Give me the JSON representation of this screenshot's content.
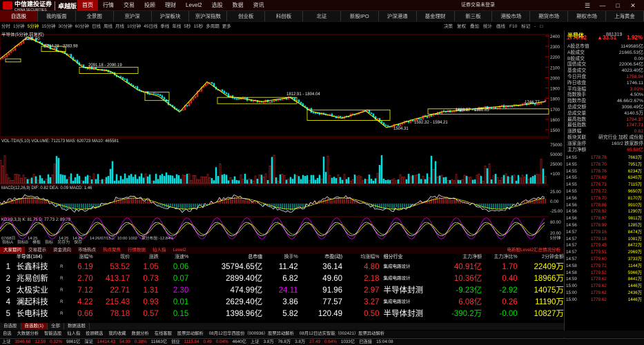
{
  "app": {
    "brand": "中信建投证券",
    "brand_sub": "CHINA SECURITIES",
    "edition": "卓越版",
    "login": "证券交易未登录"
  },
  "menu": [
    "首页",
    "行情",
    "交易",
    "投顾",
    "理财",
    "Level2",
    "选股",
    "数据",
    "资讯"
  ],
  "menu_active": 0,
  "tabs": [
    "自选股",
    "我的版面",
    "全景图",
    "京沪深",
    "沪深板块",
    "京沪深指数",
    "创业板",
    "科创板",
    "北证",
    "新股IPO",
    "沪深港通",
    "基金理财",
    "新三板",
    "港股市场",
    "期货市场",
    "期权市场",
    "上海黄金"
  ],
  "tab_active": 0,
  "periods": [
    "分时",
    "1分钟",
    "5分钟",
    "15分钟",
    "30分钟",
    "60分钟",
    "日线",
    "周线",
    "月线",
    "10分钟",
    "45日线",
    "季线",
    "年线",
    "5秒",
    "15秒",
    "多周期",
    "更多"
  ],
  "period_active": 2,
  "right_tools": [
    "决策",
    "复权",
    "叠加",
    "统计",
    "画线",
    "F10",
    "标记",
    "-",
    "□"
  ],
  "chart": {
    "title": "半导体(5分钟,前复权)",
    "annotations": [
      "2391.60",
      "2244.28 - 2383.98",
      "2091.18 - 2090.19",
      "1812.91 - 1804.04",
      "1686.57 - 1686.65",
      "1746.77",
      "1592.32 - 1594.21",
      "1504.31"
    ],
    "y_labels": [
      "2400",
      "2300",
      "2200",
      "2100",
      "2000",
      "1900",
      "1800",
      "1700",
      "1600",
      "1500"
    ],
    "vol_title": "VOL-TDX(5,10) VOLUME: 712173 MA5: 620723 MA10: 465581",
    "vol_labels": [
      "75000",
      "50000",
      "25000",
      "×100"
    ],
    "macd_title": "MACD(12,26,9) DIF: 0.82 DEA: 0.09 MACD: 1.46",
    "macd_labels": [
      "25.00",
      "0.00",
      "-25.00"
    ],
    "kdj_title": "KDJ(9,3,3) K: 81.75 D: 77.73 J: 89.79",
    "kdj_labels": [
      "80.00",
      "20.00"
    ],
    "dates": [
      "07/08日",
      "14:25",
      "14:25",
      "14:25",
      "14:26/07/15三",
      "10:00 1002",
      "某分布验:-12.84%"
    ],
    "date_right": "5分钟"
  },
  "subbar": [
    "指标A",
    "指标B",
    "模板",
    "指标",
    "另存为",
    "保存"
  ],
  "table_tabs": [
    "大家都问",
    "交易提示",
    "资金流向",
    "市场热点",
    "热点聚焦",
    "行情数据",
    "仙人指",
    "Level2"
  ],
  "table_tab_active": 0,
  "table_tab_right": "电新股Level2汇总情况分析",
  "columns": [
    "",
    "半导体(184)",
    "",
    "涨幅%",
    "现价",
    "涨跌",
    "涨速%",
    "总市值",
    "换手%",
    "市盈(动)",
    "均涨幅%",
    "细分行业",
    "主力净额",
    "主力净比%",
    "2分钟金额",
    "涨停价"
  ],
  "rows": [
    {
      "n": "1",
      "name": "长鑫科技",
      "flag": "R",
      "pct": "6.19",
      "price": "53.52",
      "chg": "1.05",
      "spd": "0.06",
      "mcap": "35794.65亿",
      "turn": "11.42",
      "pe": "36.14",
      "avg": "4.80",
      "ind": "集成电路设计",
      "net": "40.91亿",
      "netpct": "1.70",
      "amt2": "22409万",
      "lim": ""
    },
    {
      "n": "2",
      "name": "兆易创新",
      "flag": "R",
      "pct": "2.70",
      "price": "413.17",
      "chg": "0.73",
      "spd": "0.07",
      "mcap": "2899.40亿",
      "turn": "6.82",
      "pe": "49.60",
      "avg": "2.18",
      "ind": "集成电路设计",
      "net": "10.36亿",
      "netpct": "0.40",
      "amt2": "18966万",
      "lim": ""
    },
    {
      "n": "3",
      "name": "太极实业",
      "flag": "R",
      "pct": "7.12",
      "price": "22.71",
      "chg": "1.31",
      "spd": "2.30",
      "mcap": "474.99亿",
      "turn": "24.11",
      "pe": "91.96",
      "avg": "2.97",
      "ind": "半导体封测",
      "net": "-9.23亿",
      "netpct": "-2.92",
      "amt2": "14075万",
      "lim": ""
    },
    {
      "n": "4",
      "name": "澜起科技",
      "flag": "R",
      "pct": "4.22",
      "price": "215.43",
      "chg": "0.93",
      "spd": "0.01",
      "mcap": "2629.40亿",
      "turn": "3.86",
      "pe": "77.57",
      "avg": "3.27",
      "ind": "集成电路设计",
      "net": "6.08亿",
      "netpct": "0.26",
      "amt2": "11190万",
      "lim": ""
    },
    {
      "n": "5",
      "name": "长电科技",
      "flag": "R",
      "pct": "0.66",
      "price": "78.18",
      "chg": "0.57",
      "spd": "0.15",
      "mcap": "1398.96亿",
      "turn": "5.82",
      "pe": "120.49",
      "avg": "0.50",
      "ind": "半导体封测",
      "net": "-390.2万",
      "netpct": "-0.00",
      "amt2": "10827万",
      "lim": ""
    }
  ],
  "bottom_tabs": [
    "自选股",
    "自选股(1)",
    "全部",
    "数据选股"
  ],
  "toolbar2": [
    "自选",
    "大数据分析",
    "智能选股",
    "仙人指",
    "投顾精选",
    "我的收藏",
    "数据分析",
    "在线客服",
    "股票异动解析",
    "08月12日华西股份（000936）股票异动解析",
    "08月12日达实智能（002421）股票异动解析"
  ],
  "status": [
    "上证",
    "3946.68",
    "12.59",
    "0.32%",
    "9861亿",
    "深证",
    "14414.43",
    "54.99",
    "0.38%",
    "11663亿",
    "创业",
    "1115.84",
    "0.49",
    "0.04%",
    "4640亿",
    "上证",
    "3.8万",
    "76.8万",
    "3.8万",
    "27.49",
    "0.64%",
    "1033亿",
    "已连接",
    "15:04:08"
  ],
  "right_panel": {
    "name": "半导体",
    "code": "881319",
    "price": "1779.62",
    "change": "▲33.51",
    "pct": "1.92%",
    "kv": [
      [
        "A股总市值",
        "1149585亿"
      ],
      [
        "A股成交",
        "21665.53亿"
      ],
      [
        "B股成交",
        "0.00"
      ],
      [
        "国债成交",
        "22006.54亿"
      ],
      [
        "基金成交",
        "4023.40亿"
      ],
      [
        "今日开盘",
        "1758.94"
      ],
      [
        "昨日收盘",
        "1746.11"
      ],
      [
        "平均涨幅",
        "3.01%"
      ],
      [
        "指数换手",
        "4.50%"
      ],
      [
        "指数市盈",
        "46.66/2.67%"
      ],
      [
        "总成交额",
        "3098.49亿"
      ],
      [
        "总成交量",
        "4140.5万"
      ],
      [
        "最高指数",
        "1794.37"
      ],
      [
        "最低指数",
        "1747.71"
      ],
      [
        "涨跌幅",
        "0.82"
      ],
      [
        "板块关联",
        "研究行业 加权 成份股"
      ],
      [
        "涨家涨停",
        "160/2 跌家跌停"
      ],
      [
        "主力净额",
        "65.58亿"
      ]
    ],
    "ticks": [
      [
        "14:55",
        "1778.78",
        "7663万"
      ],
      [
        "14:55",
        "1778.70",
        "7951万"
      ],
      [
        "14:55",
        "1778.76",
        "6234万"
      ],
      [
        "14:55",
        "1778.69",
        "6345万"
      ],
      [
        "14:55",
        "1778.73",
        "7115万"
      ],
      [
        "14:55",
        "1778.72",
        "9650万"
      ],
      [
        "14:56",
        "1778.70",
        "8170万"
      ],
      [
        "14:56",
        "1778.86",
        "9910万"
      ],
      [
        "14:56",
        "1778.92",
        "1290万"
      ],
      [
        "14:56",
        "1778.97",
        "9811万"
      ],
      [
        "14:56",
        "1778.99",
        "1285万"
      ],
      [
        "14:57",
        "1779.16",
        "8474万"
      ],
      [
        "14:57",
        "1779.18",
        "1081万"
      ],
      [
        "14:57",
        "1779.45",
        "8472万"
      ],
      [
        "14:57",
        "1779.51",
        "2969万"
      ],
      [
        "14:57",
        "1779.60",
        "3733万"
      ],
      [
        "14:58",
        "1779.72",
        "1144万"
      ],
      [
        "14:58",
        "1779.52",
        "5966万"
      ],
      [
        "14:59",
        "1779.62",
        "8441万"
      ],
      [
        "15:00",
        "1779.62",
        "1446万"
      ],
      [
        "15:00",
        "1779.62",
        "2436万"
      ],
      [
        "15:00",
        "1779.62",
        "1446万"
      ]
    ]
  },
  "colors": {
    "up": "#ff3232",
    "down": "#00e000",
    "accent": "#900000",
    "highlight": "#ffff00"
  }
}
